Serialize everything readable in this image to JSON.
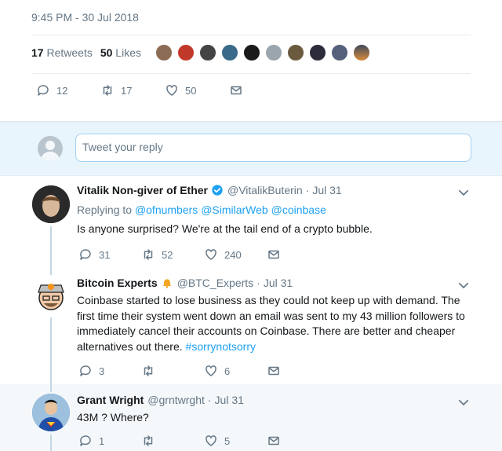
{
  "tweet": {
    "timestamp": "9:45 PM - 30 Jul 2018",
    "retweets_count": "17",
    "retweets_label": "Retweets",
    "likes_count": "50",
    "likes_label": "Likes",
    "reply_count": "12",
    "retweet_count": "17",
    "like_count": "50"
  },
  "reply_box": {
    "placeholder": "Tweet your reply"
  },
  "replies": [
    {
      "name": "Vitalik Non-giver of Ether",
      "handle": "@VitalikButerin",
      "sep": "·",
      "time": "Jul 31",
      "replying_label": "Replying to",
      "mentions": [
        "@ofnumbers",
        "@SimilarWeb",
        "@coinbase"
      ],
      "text": "Is anyone surprised? We're at the tail end of a crypto bubble.",
      "reply_count": "31",
      "retweet_count": "52",
      "like_count": "240"
    },
    {
      "name": "Bitcoin Experts",
      "handle": "@BTC_Experts",
      "sep": "·",
      "time": "Jul 31",
      "text": "Coinbase started to lose business as they could not keep up with demand.  The first time their system went down an email was sent to my 43 million followers to immediately cancel their accounts on Coinbase.  There are better and cheaper alternatives out there.",
      "hashtag": "#sorrynotsorry",
      "reply_count": "3",
      "retweet_count": "",
      "like_count": "6"
    },
    {
      "name": "Grant Wright",
      "handle": "@grntwrght",
      "sep": "·",
      "time": "Jul 31",
      "text": "43M ? Where?",
      "reply_count": "1",
      "retweet_count": "",
      "like_count": "5"
    }
  ],
  "colors": {
    "accent": "#1da1f2",
    "muted": "#657786",
    "background": "#e6ecf0",
    "highlight": "#f5f8fa"
  }
}
